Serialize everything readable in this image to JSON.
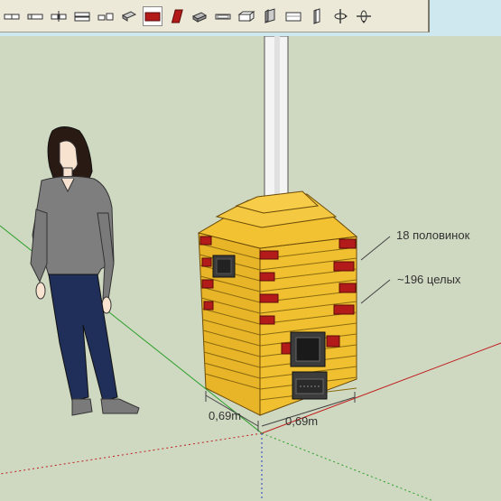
{
  "colors": {
    "ground": "#cfd8c0",
    "sky": "#cfe8ef",
    "brick_yellow": "#f0c030",
    "brick_red": "#b31a1a",
    "mortar": "#8a6a10",
    "axis_green": "#2aa02a",
    "axis_red": "#c02020",
    "toolbar_bg": "#ece9d8"
  },
  "toolbar": {
    "buttons": [
      {
        "name": "brick-stretcher-icon",
        "active": false
      },
      {
        "name": "brick-end-icon",
        "active": false
      },
      {
        "name": "brick-half-icon",
        "active": false
      },
      {
        "name": "brick-row-icon",
        "active": false
      },
      {
        "name": "brick-pair-icon",
        "active": false
      },
      {
        "name": "brick-angle-icon",
        "active": false
      },
      {
        "name": "brick-red-flat-icon",
        "active": false
      },
      {
        "name": "brick-red-side-icon",
        "active": false
      },
      {
        "name": "brick-gray-icon",
        "active": false
      },
      {
        "name": "brick-outline-icon",
        "active": false
      },
      {
        "name": "brick-outline-3d-icon",
        "active": false
      },
      {
        "name": "brick-edge-icon",
        "active": false
      },
      {
        "name": "brick-box-icon",
        "active": false
      },
      {
        "name": "brick-tall-icon",
        "active": false
      },
      {
        "name": "rotate-vertical-icon",
        "active": false
      },
      {
        "name": "rotate-horizontal-icon",
        "active": false
      }
    ]
  },
  "scene": {
    "annotation_halves": "18 половинок",
    "annotation_whole": "~196 целых",
    "dimension_left": "0,69m",
    "dimension_right": "0,69m"
  }
}
